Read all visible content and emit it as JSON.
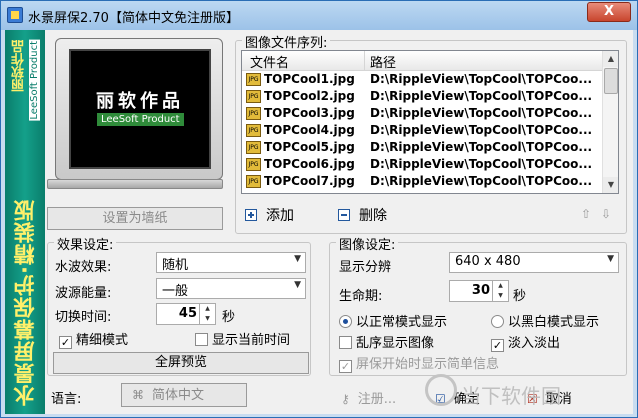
{
  "title": "水景屏保2.70【简体中文免注册版】",
  "close_label": "X",
  "banner": {
    "main": "水景屏幕保护·精装版",
    "brand_cn": "丽软作品",
    "brand_en": "LeeSoft Product"
  },
  "preview": {
    "title": "丽软作品",
    "subtitle": "LeeSoft Product"
  },
  "set_wallpaper": "设置为墙纸",
  "file_list": {
    "legend": "图像文件序列:",
    "col_name": "文件名",
    "col_path": "路径",
    "rows": [
      {
        "name": "TOPCool1.jpg",
        "path": "D:\\RippleView\\TopCool\\TOPCoo..."
      },
      {
        "name": "TOPCool2.jpg",
        "path": "D:\\RippleView\\TopCool\\TOPCoo..."
      },
      {
        "name": "TOPCool3.jpg",
        "path": "D:\\RippleView\\TopCool\\TOPCoo..."
      },
      {
        "name": "TOPCool4.jpg",
        "path": "D:\\RippleView\\TopCool\\TOPCoo..."
      },
      {
        "name": "TOPCool5.jpg",
        "path": "D:\\RippleView\\TopCool\\TOPCoo..."
      },
      {
        "name": "TOPCool6.jpg",
        "path": "D:\\RippleView\\TopCool\\TOPCoo..."
      },
      {
        "name": "TOPCool7.jpg",
        "path": "D:\\RippleView\\TopCool\\TOPCoo..."
      }
    ],
    "add": "添加",
    "delete": "删除",
    "file_icon_text": "JPG"
  },
  "effects": {
    "legend": "效果设定:",
    "water_label": "水波效果:",
    "water_value": "随机",
    "energy_label": "波源能量:",
    "energy_value": "一般",
    "interval_label": "切换时间:",
    "interval_value": "45",
    "interval_unit": "秒",
    "fine_mode": "精细模式",
    "fine_mode_checked": true,
    "show_time": "显示当前时间",
    "show_time_checked": false,
    "fullscreen_preview": "全屏预览"
  },
  "image_settings": {
    "legend": "图像设定:",
    "resolution_label": "显示分辨",
    "resolution_value": "640 x 480",
    "lifetime_label": "生命期:",
    "lifetime_value": "30",
    "lifetime_unit": "秒",
    "normal_mode": "以正常模式显示",
    "bw_mode": "以黑白模式显示",
    "shuffle": "乱序显示图像",
    "fade": "淡入淡出",
    "fade_checked": true,
    "start_msg": "屏保开始时显示简单信息"
  },
  "bottom": {
    "language_label": "语言:",
    "language_value": "简体中文",
    "register": "注册...",
    "ok": "确定",
    "cancel": "取消"
  },
  "watermark": "当下软件园",
  "colors": {
    "banner": "#0a7d6b",
    "title_bar": "#9cc2e8",
    "close": "#c8452e"
  }
}
